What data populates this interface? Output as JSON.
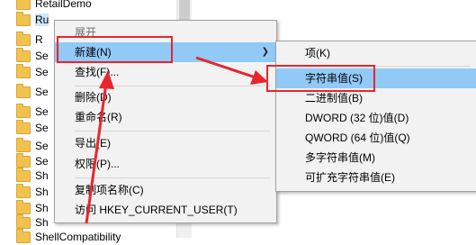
{
  "tree": {
    "items": [
      "RetailDemo",
      "Ru",
      "R",
      "Se",
      "Se",
      "Se",
      "Se",
      "Se",
      "Se",
      "Se",
      "Sh",
      "Sh",
      "Sh",
      "Sh",
      "ShellCompatibility"
    ]
  },
  "context_menu": {
    "expand": "展开",
    "new": "新建(N)",
    "find": "查找(F)...",
    "delete": "删除(D)",
    "rename": "重命名(R)",
    "export": "导出(E)",
    "permissions": "权限(P)...",
    "copy_key_name": "复制项名称(C)",
    "goto": "访问 HKEY_CURRENT_USER(T)"
  },
  "submenu": {
    "key": "项(K)",
    "string_value": "字符串值(S)",
    "binary_value": "二进制值(B)",
    "dword_value": "DWORD (32 位)值(D)",
    "qword_value": "QWORD (64 位)值(Q)",
    "multi_string_value": "多字符串值(M)",
    "expandable_string_value": "可扩充字符串值(E)"
  },
  "colors": {
    "highlight": "#91c9f7",
    "annotation_red": "#e8262b",
    "menu_bg": "#f2f2f2"
  }
}
